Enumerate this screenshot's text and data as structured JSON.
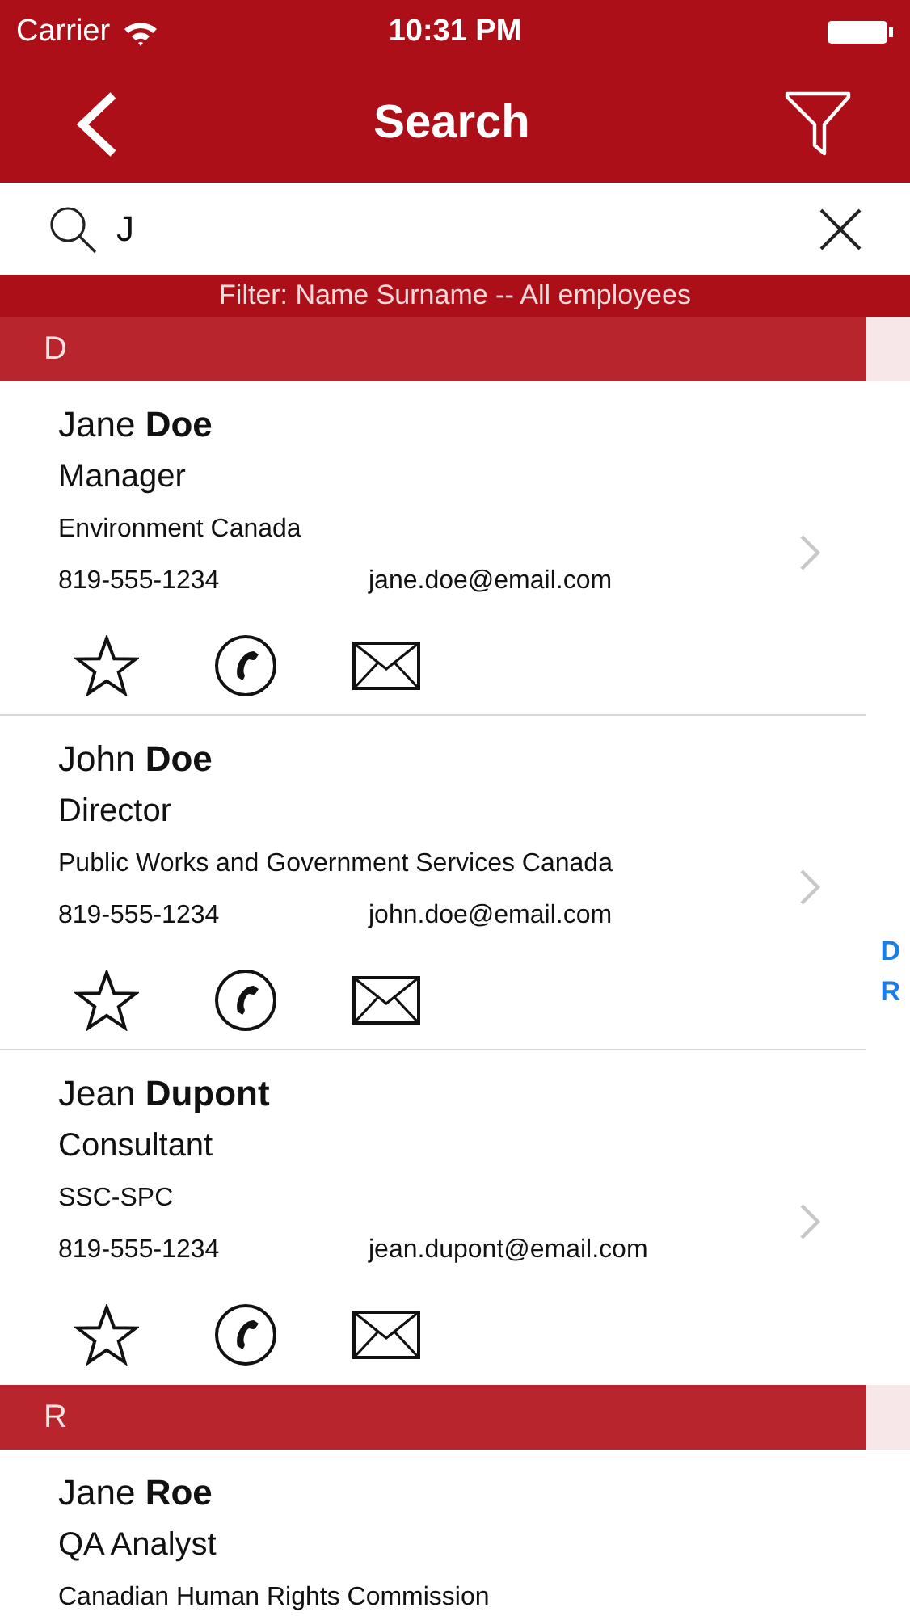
{
  "status_bar": {
    "carrier": "Carrier",
    "time": "10:31 PM"
  },
  "nav": {
    "title": "Search"
  },
  "search": {
    "value": "J"
  },
  "filter": "Filter: Name Surname -- All employees",
  "sections": [
    {
      "letter": "D",
      "contacts": [
        {
          "name": "Jane **Doe**",
          "title": "Manager",
          "organization": "Environment Canada",
          "phone": "819-555-1234",
          "email": "jane.doe@email.com"
        },
        {
          "name": "John **Doe**",
          "title": "Director",
          "organization": "Public Works and Government Services Canada",
          "phone": "819-555-1234",
          "email": "john.doe@email.com"
        },
        {
          "name": "Jean **Dupont**",
          "title": "Consultant",
          "organization": "SSC-SPC",
          "phone": "819-555-1234",
          "email": "jean.dupont@email.com"
        }
      ]
    },
    {
      "letter": "R",
      "contacts": [
        {
          "name": "Jane **Roe**",
          "title": "QA Analyst",
          "organization": "Canadian Human Rights Commission"
        }
      ]
    }
  ],
  "index": [
    "D",
    "R"
  ]
}
